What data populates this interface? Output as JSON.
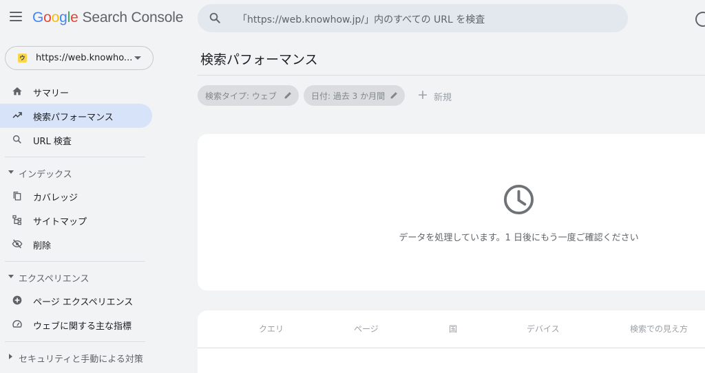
{
  "header": {
    "logo": {
      "g1": "G",
      "g2": "o",
      "g3": "o",
      "g4": "g",
      "g5": "l",
      "g6": "e",
      "product": "Search Console"
    },
    "search_placeholder": "「https://web.knowhow.jp/」内のすべての URL を検査"
  },
  "sidebar": {
    "property_label": "https://web.knowho...",
    "property_favicon": "ウ",
    "items": [
      {
        "label": "サマリー",
        "icon": "home-icon"
      },
      {
        "label": "検索パフォーマンス",
        "icon": "trending-up-icon",
        "active": true
      },
      {
        "label": "URL 検査",
        "icon": "search-icon"
      }
    ],
    "sections": [
      {
        "label": "インデックス",
        "expanded": true,
        "items": [
          {
            "label": "カバレッジ",
            "icon": "copy-icon"
          },
          {
            "label": "サイトマップ",
            "icon": "sitemap-icon"
          },
          {
            "label": "削除",
            "icon": "visibility-off-icon"
          }
        ]
      },
      {
        "label": "エクスペリエンス",
        "expanded": true,
        "items": [
          {
            "label": "ページ エクスペリエンス",
            "icon": "add-circle-icon"
          },
          {
            "label": "ウェブに関する主な指標",
            "icon": "speed-icon"
          }
        ]
      },
      {
        "label": "セキュリティと手動による対策",
        "expanded": false,
        "items": []
      }
    ]
  },
  "main": {
    "title": "検索パフォーマンス",
    "filters": [
      {
        "label": "検索タイプ: ウェブ"
      },
      {
        "label": "日付: 過去 3 か月間"
      }
    ],
    "new_label": "新規",
    "processing_message": "データを処理しています。1 日後にもう一度ご確認ください",
    "table_tabs": [
      "クエリ",
      "ページ",
      "国",
      "デバイス",
      "検索での見え方"
    ]
  },
  "colors": {
    "background": "#f1f3f4",
    "active_nav": "#d7e3f8",
    "search_bg": "#e3e7ee",
    "card_bg": "#ffffff"
  }
}
